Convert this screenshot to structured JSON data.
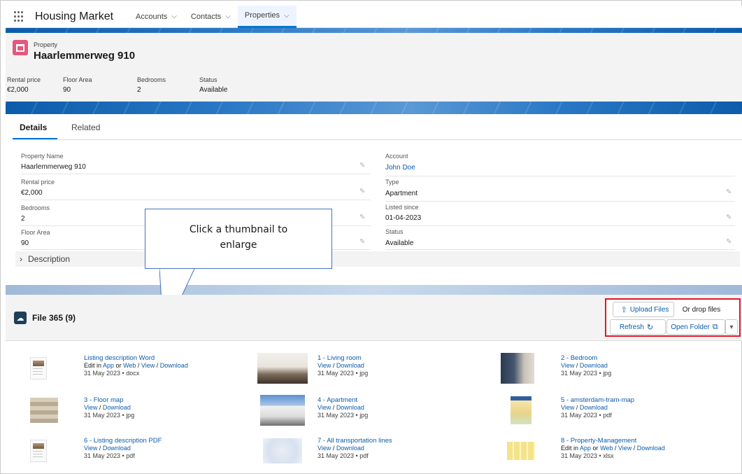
{
  "nav": {
    "app_name": "Housing Market",
    "tabs": [
      {
        "label": "Accounts"
      },
      {
        "label": "Contacts"
      },
      {
        "label": "Properties"
      }
    ]
  },
  "record": {
    "object_label": "Property",
    "title": "Haarlemmerweg 910",
    "highlights": [
      {
        "label": "Rental price",
        "value": "€2,000"
      },
      {
        "label": "Floor Area",
        "value": "90"
      },
      {
        "label": "Bedrooms",
        "value": "2"
      },
      {
        "label": "Status",
        "value": "Available"
      }
    ]
  },
  "detail_tabs": [
    "Details",
    "Related"
  ],
  "details": {
    "left": [
      {
        "label": "Property Name",
        "value": "Haarlemmerweg 910"
      },
      {
        "label": "Rental price",
        "value": "€2,000"
      },
      {
        "label": "Bedrooms",
        "value": "2"
      },
      {
        "label": "Floor Area",
        "value": "90"
      }
    ],
    "right": [
      {
        "label": "Account",
        "value": "John Doe"
      },
      {
        "label": "Type",
        "value": "Apartment"
      },
      {
        "label": "Listed since",
        "value": "01-04-2023"
      },
      {
        "label": "Status",
        "value": "Available"
      }
    ],
    "description_label": "Description"
  },
  "callout": {
    "line1": "Click a thumbnail to",
    "line2": "enlarge"
  },
  "files": {
    "title": "File 365 (9)",
    "upload_label": "Upload Files",
    "drop_label": "Or drop files",
    "refresh_label": "Refresh",
    "open_folder_label": "Open Folder",
    "items": [
      {
        "name": "Listing description Word",
        "actions": [
          "Edit in ",
          "App",
          " or ",
          "Web",
          " / ",
          "View",
          " / ",
          "Download"
        ],
        "meta": "31 May 2023 • docx"
      },
      {
        "name": "1 - Living room",
        "actions": [
          "View",
          " / ",
          "Download"
        ],
        "meta": "31 May 2023 • jpg"
      },
      {
        "name": "2 - Bedroom",
        "actions": [
          "View",
          " / ",
          "Download"
        ],
        "meta": "31 May 2023 • jpg"
      },
      {
        "name": "3 - Floor map",
        "actions": [
          "View",
          " / ",
          "Download"
        ],
        "meta": "31 May 2023 • jpg"
      },
      {
        "name": "4 - Apartment",
        "actions": [
          "View",
          " / ",
          "Download"
        ],
        "meta": "31 May 2023 • jpg"
      },
      {
        "name": "5 - amsterdam-tram-map",
        "actions": [
          "View",
          " / ",
          "Download"
        ],
        "meta": "31 May 2023 • pdf"
      },
      {
        "name": "6 - Listing description PDF",
        "actions": [
          "View",
          " / ",
          "Download"
        ],
        "meta": "31 May 2023 • pdf"
      },
      {
        "name": "7 - All transportation lines",
        "actions": [
          "View",
          " / ",
          "Download"
        ],
        "meta": "31 May 2023 • pdf"
      },
      {
        "name": "8 - Property-Management",
        "actions": [
          "Edit in ",
          "App",
          " or ",
          "Web",
          " / ",
          "View",
          " / ",
          "Download"
        ],
        "meta": "31 May 2023 • xlsx"
      }
    ]
  },
  "colors": {
    "brand_blue": "#0176d3",
    "link": "#0b5cab",
    "record_icon": "#e2597d",
    "highlight_box": "#e0162b"
  }
}
